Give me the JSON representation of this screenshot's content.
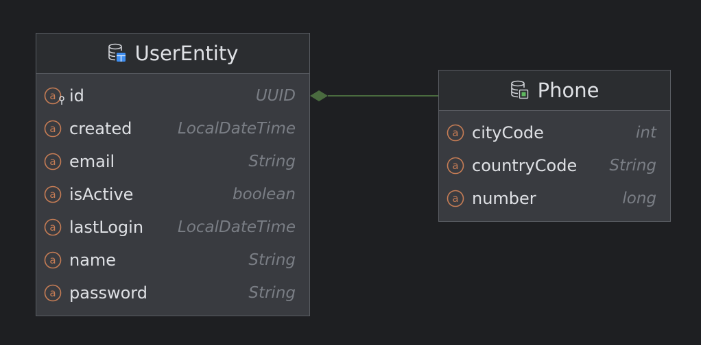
{
  "entities": [
    {
      "name": "UserEntity",
      "fields": [
        {
          "name": "id",
          "type": "UUID",
          "key": true
        },
        {
          "name": "created",
          "type": "LocalDateTime"
        },
        {
          "name": "email",
          "type": "String"
        },
        {
          "name": "isActive",
          "type": "boolean"
        },
        {
          "name": "lastLogin",
          "type": "LocalDateTime"
        },
        {
          "name": "name",
          "type": "String"
        },
        {
          "name": "password",
          "type": "String"
        }
      ]
    },
    {
      "name": "Phone",
      "fields": [
        {
          "name": "cityCode",
          "type": "int"
        },
        {
          "name": "countryCode",
          "type": "String"
        },
        {
          "name": "number",
          "type": "long"
        }
      ]
    }
  ],
  "relation": {
    "from": "UserEntity",
    "to": "Phone",
    "kind": "composition",
    "color": "#4a6b3f"
  },
  "icons": {
    "field": "field-a-icon",
    "key": "key-icon",
    "entity_user": "entity-table-icon",
    "entity_phone": "entity-embeddable-icon"
  },
  "colors": {
    "field_icon": "#c77d55",
    "header_icon_blue": "#3f8ef0",
    "header_icon_green": "#5fb85f"
  }
}
